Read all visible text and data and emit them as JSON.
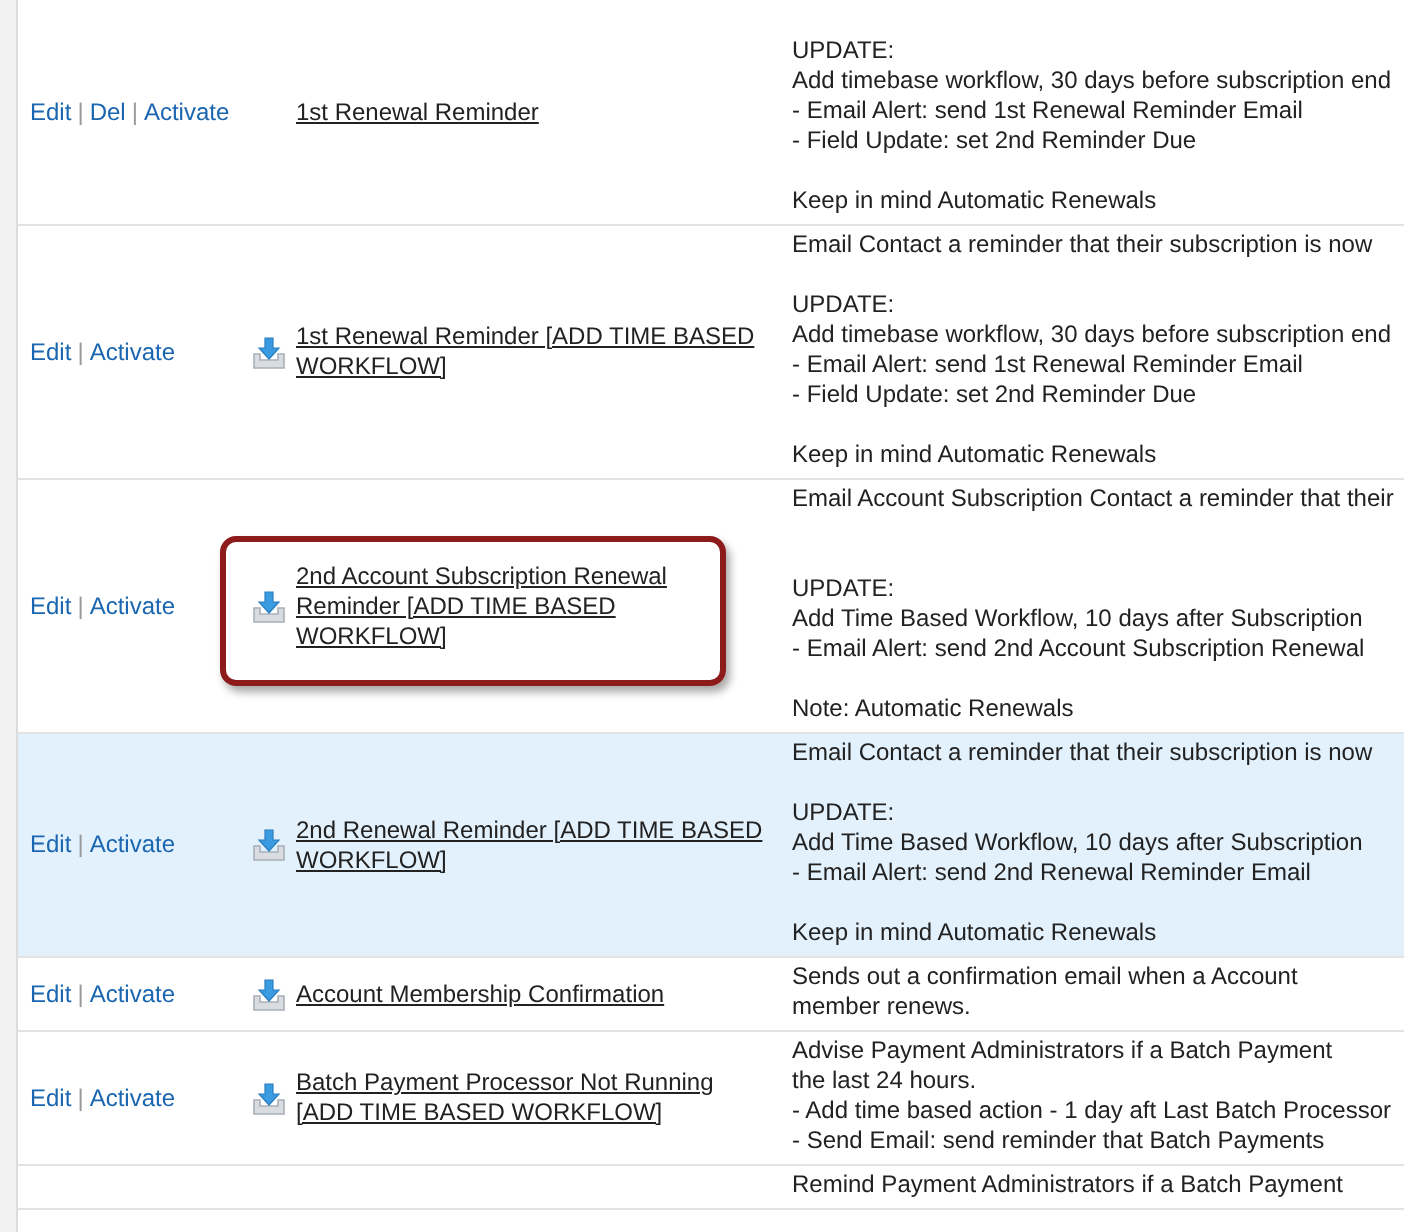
{
  "separator": "|",
  "rows": [
    {
      "actions": [
        "Edit",
        "Del",
        "Activate"
      ],
      "icon": false,
      "name": "1st Renewal Reminder",
      "highlighted": false,
      "callout": false,
      "lead": true,
      "description": [
        {
          "lines": [
            "UPDATE:",
            "Add timebase workflow, 30 days before subscription end",
            "- Email Alert: send 1st Renewal Reminder Email",
            "- Field Update: set 2nd Reminder Due"
          ]
        },
        {
          "lines": [
            "Keep in mind Automatic Renewals"
          ]
        }
      ]
    },
    {
      "actions": [
        "Edit",
        "Activate"
      ],
      "icon": true,
      "name": "1st Renewal Reminder [ADD TIME BASED WORKFLOW]",
      "highlighted": false,
      "callout": false,
      "lead": false,
      "description": [
        {
          "lines": [
            "Email Contact a reminder that their subscription is now"
          ]
        },
        {
          "lines": [
            "UPDATE:",
            "Add timebase workflow, 30 days before subscription end",
            "- Email Alert: send 1st Renewal Reminder Email",
            "- Field Update: set 2nd Reminder Due"
          ]
        },
        {
          "lines": [
            "Keep in mind Automatic Renewals"
          ]
        }
      ]
    },
    {
      "actions": [
        "Edit",
        "Activate"
      ],
      "icon": true,
      "name": "2nd Account Subscription Renewal Reminder [ADD TIME BASED WORKFLOW]",
      "highlighted": false,
      "callout": true,
      "lead": false,
      "description": [
        {
          "lines": [
            "Email Account Subscription Contact a reminder that their"
          ],
          "wide_gap": true
        },
        {
          "lines": [
            "UPDATE:",
            "Add Time Based Workflow, 10 days after Subscription",
            "- Email Alert: send 2nd Account Subscription Renewal"
          ]
        },
        {
          "lines": [
            "Note: Automatic Renewals"
          ]
        }
      ]
    },
    {
      "actions": [
        "Edit",
        "Activate"
      ],
      "icon": true,
      "name": "2nd Renewal Reminder [ADD TIME BASED WORKFLOW]",
      "highlighted": true,
      "callout": false,
      "lead": false,
      "description": [
        {
          "lines": [
            "Email Contact a reminder that their subscription is now"
          ]
        },
        {
          "lines": [
            "UPDATE:",
            "Add Time Based Workflow, 10 days after Subscription",
            "- Email Alert: send 2nd Renewal Reminder Email"
          ]
        },
        {
          "lines": [
            "Keep in mind Automatic Renewals"
          ]
        }
      ]
    },
    {
      "actions": [
        "Edit",
        "Activate"
      ],
      "icon": true,
      "name": "Account Membership Confirmation",
      "highlighted": false,
      "callout": false,
      "lead": false,
      "description": [
        {
          "lines": [
            "Sends out a confirmation email when a Account",
            "member renews."
          ]
        }
      ]
    },
    {
      "actions": [
        "Edit",
        "Activate"
      ],
      "icon": true,
      "name": "Batch Payment Processor Not Running [ADD TIME BASED WORKFLOW]",
      "highlighted": false,
      "callout": false,
      "lead": false,
      "description": [
        {
          "lines": [
            "Advise Payment Administrators if a Batch Payment",
            "the last 24 hours.",
            "- Add time based action - 1 day aft Last Batch Processor",
            "- Send Email: send reminder that Batch Payments"
          ]
        }
      ]
    },
    {
      "actions": [],
      "icon": false,
      "name": "",
      "highlighted": false,
      "callout": false,
      "lead": false,
      "description": [
        {
          "lines": [
            "Remind Payment Administrators if a Batch Payment"
          ]
        }
      ]
    }
  ]
}
